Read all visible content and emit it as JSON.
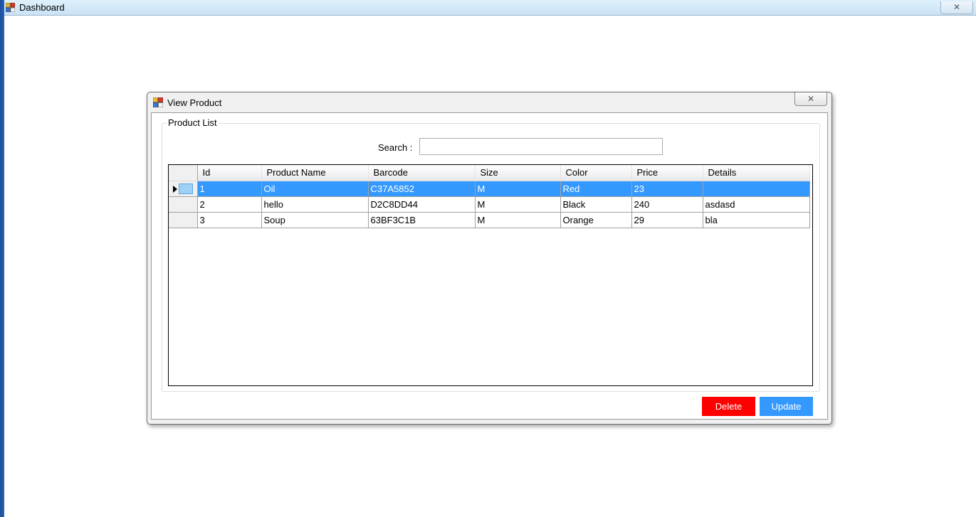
{
  "main_window": {
    "title": "Dashboard",
    "close_glyph": "✕"
  },
  "dialog": {
    "title": "View Product",
    "close_glyph": "✕",
    "groupbox_title": "Product List",
    "search": {
      "label": "Search :",
      "value": "",
      "placeholder": ""
    },
    "grid": {
      "columns": [
        "Id",
        "Product Name",
        "Barcode",
        "Size",
        "Color",
        "Price",
        "Details"
      ],
      "rows": [
        [
          "1",
          "Oil",
          "C37A5852",
          "M",
          "Red",
          "23",
          ""
        ],
        [
          "2",
          "hello",
          "D2C8DD44",
          "M",
          "Black",
          "240",
          "asdasd"
        ],
        [
          "3",
          "Soup",
          "63BF3C1B",
          "M",
          "Orange",
          "29",
          "bla"
        ]
      ],
      "selected_row": 0
    },
    "buttons": {
      "delete_label": "Delete",
      "update_label": "Update"
    }
  },
  "colors": {
    "selection": "#3399ff",
    "delete_button": "#ff0000",
    "update_button": "#3399ff"
  },
  "icons": {
    "app_icon": "app-window-icon",
    "row_pointer": "triangle-right-icon"
  }
}
